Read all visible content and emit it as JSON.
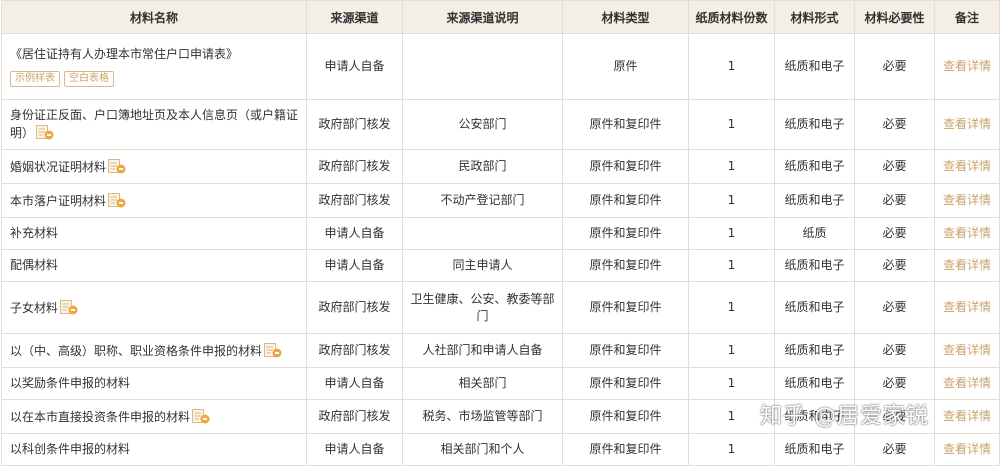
{
  "headers": [
    "材料名称",
    "来源渠道",
    "来源渠道说明",
    "材料类型",
    "纸质材料份数",
    "材料形式",
    "材料必要性",
    "备注"
  ],
  "rows": [
    {
      "name": "《居住证持有人办理本市常住户口申请表》",
      "channel": "申请人自备",
      "desc": "",
      "type": "原件",
      "copies": "1",
      "form": "纸质和电子",
      "necessity": "必要",
      "note": "查看详情",
      "tags": [
        "示例样表",
        "空白表格"
      ]
    },
    {
      "name": "身份证正反面、户口簿地址页及本人信息页（或户籍证明）",
      "channel": "政府部门核发",
      "desc": "公安部门",
      "type": "原件和复印件",
      "copies": "1",
      "form": "纸质和电子",
      "necessity": "必要",
      "note": "查看详情",
      "exempt": true
    },
    {
      "name": "婚姻状况证明材料",
      "channel": "政府部门核发",
      "desc": "民政部门",
      "type": "原件和复印件",
      "copies": "1",
      "form": "纸质和电子",
      "necessity": "必要",
      "note": "查看详情",
      "exempt": true
    },
    {
      "name": "本市落户证明材料",
      "channel": "政府部门核发",
      "desc": "不动产登记部门",
      "type": "原件和复印件",
      "copies": "1",
      "form": "纸质和电子",
      "necessity": "必要",
      "note": "查看详情",
      "exempt": true
    },
    {
      "name": "补充材料",
      "channel": "申请人自备",
      "desc": "",
      "type": "原件和复印件",
      "copies": "1",
      "form": "纸质",
      "necessity": "必要",
      "note": "查看详情"
    },
    {
      "name": "配偶材料",
      "channel": "申请人自备",
      "desc": "同主申请人",
      "type": "原件和复印件",
      "copies": "1",
      "form": "纸质和电子",
      "necessity": "必要",
      "note": "查看详情"
    },
    {
      "name": "子女材料",
      "channel": "政府部门核发",
      "desc": "卫生健康、公安、教委等部门",
      "type": "原件和复印件",
      "copies": "1",
      "form": "纸质和电子",
      "necessity": "必要",
      "note": "查看详情",
      "exempt": true
    },
    {
      "name": "以（中、高级）职称、职业资格条件申报的材料",
      "channel": "政府部门核发",
      "desc": "人社部门和申请人自备",
      "type": "原件和复印件",
      "copies": "1",
      "form": "纸质和电子",
      "necessity": "必要",
      "note": "查看详情",
      "exempt": true
    },
    {
      "name": "以奖励条件申报的材料",
      "channel": "申请人自备",
      "desc": "相关部门",
      "type": "原件和复印件",
      "copies": "1",
      "form": "纸质和电子",
      "necessity": "必要",
      "note": "查看详情"
    },
    {
      "name": "以在本市直接投资条件申报的材料",
      "channel": "政府部门核发",
      "desc": "税务、市场监管等部门",
      "type": "原件和复印件",
      "copies": "1",
      "form": "纸质和电子",
      "necessity": "必要",
      "note": "查看详情",
      "exempt": true
    },
    {
      "name": "以科创条件申报的材料",
      "channel": "申请人自备",
      "desc": "相关部门和个人",
      "type": "原件和复印件",
      "copies": "1",
      "form": "纸质和电子",
      "necessity": "必要",
      "note": "查看详情"
    }
  ],
  "watermark": "知乎 @居爱家锐",
  "colors": {
    "header_bg": "#f3efe7",
    "link": "#c9a36b",
    "border": "#e3ddd3"
  },
  "icons": {
    "exempt": "mian-exempt-icon"
  }
}
